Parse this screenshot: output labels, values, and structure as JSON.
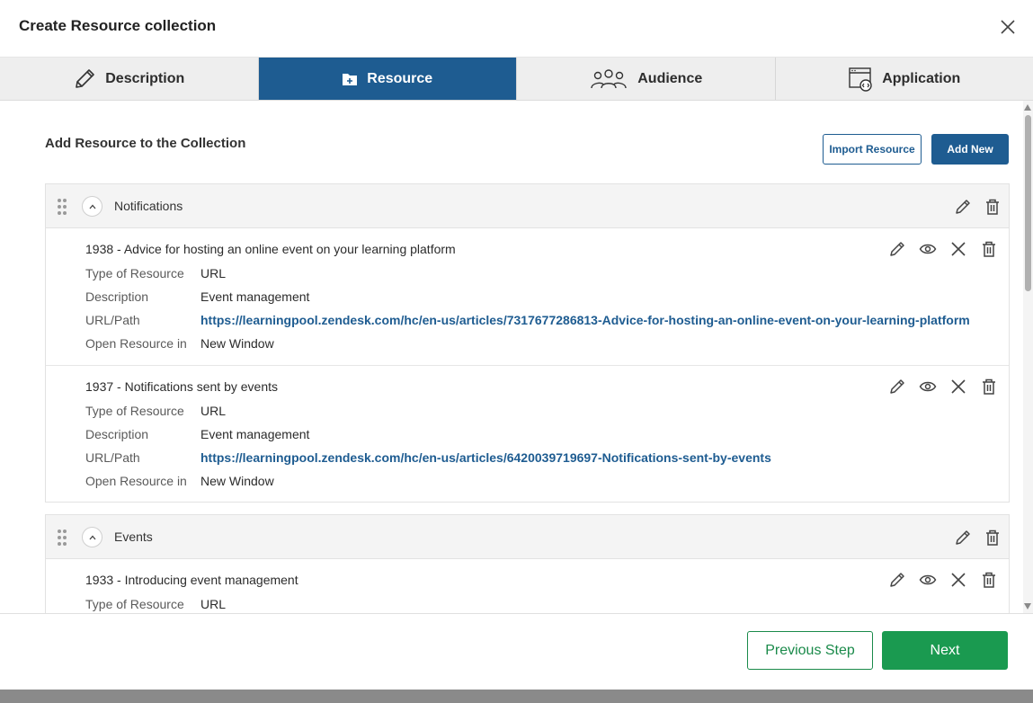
{
  "dialog": {
    "title": "Create Resource collection"
  },
  "tabs": [
    {
      "label": "Description",
      "icon": "pencil-icon"
    },
    {
      "label": "Resource",
      "icon": "folder-plus-icon",
      "active": true
    },
    {
      "label": "Audience",
      "icon": "people-icon"
    },
    {
      "label": "Application",
      "icon": "application-window-icon"
    }
  ],
  "content": {
    "heading": "Add Resource to the Collection",
    "import_label": "Import Resource",
    "add_new_label": "Add New"
  },
  "field_labels": {
    "type": "Type of Resource",
    "description": "Description",
    "url": "URL/Path",
    "open_in": "Open Resource in"
  },
  "groups": [
    {
      "name": "Notifications",
      "resources": [
        {
          "title": "1938 - Advice for hosting an online event on your learning platform",
          "type": "URL",
          "description": "Event management",
          "url": "https://learningpool.zendesk.com/hc/en-us/articles/7317677286813-Advice-for-hosting-an-online-event-on-your-learning-platform",
          "open_in": "New Window"
        },
        {
          "title": "1937 - Notifications sent by events",
          "type": "URL",
          "description": "Event management",
          "url": "https://learningpool.zendesk.com/hc/en-us/articles/6420039719697-Notifications-sent-by-events",
          "open_in": "New Window"
        }
      ]
    },
    {
      "name": "Events",
      "resources": [
        {
          "title": "1933 - Introducing event management",
          "type": "URL"
        }
      ]
    }
  ],
  "footer": {
    "previous_label": "Previous Step",
    "next_label": "Next"
  },
  "colors": {
    "primary": "#1e5c91",
    "success": "#1a9a50"
  }
}
